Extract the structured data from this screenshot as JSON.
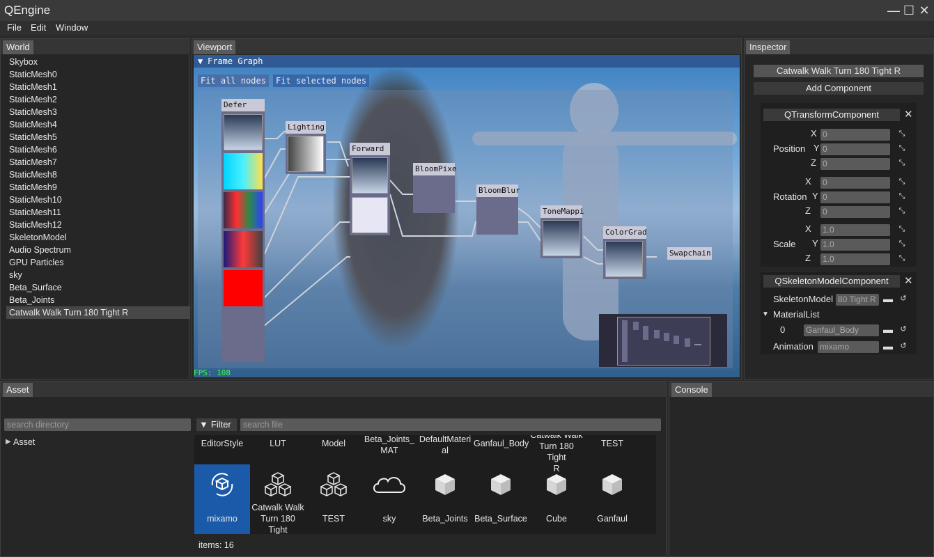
{
  "app": {
    "title": "QEngine"
  },
  "menu": [
    "File",
    "Edit",
    "Window"
  ],
  "world": {
    "tab": "World",
    "items": [
      "Skybox",
      "StaticMesh0",
      "StaticMesh1",
      "StaticMesh2",
      "StaticMesh3",
      "StaticMesh4",
      "StaticMesh5",
      "StaticMesh6",
      "StaticMesh7",
      "StaticMesh8",
      "StaticMesh9",
      "StaticMesh10",
      "StaticMesh11",
      "StaticMesh12",
      "SkeletonModel",
      "Audio Spectrum",
      "GPU Particles",
      "sky",
      "Beta_Surface",
      "Beta_Joints",
      "Catwalk Walk Turn 180 Tight R"
    ],
    "selected_index": 20
  },
  "viewport": {
    "tab": "Viewport",
    "frame_graph_title": "Frame Graph",
    "fit_all": "Fit all nodes",
    "fit_selected": "Fit selected nodes",
    "fps": "FPS: 108",
    "nodes": [
      "Defer",
      "Lighting",
      "Forward",
      "BloomPixe",
      "BloomBlur",
      "ToneMappi",
      "ColorGrad",
      "Swapchain"
    ]
  },
  "inspector": {
    "tab": "Inspector",
    "object_name": "Catwalk Walk Turn 180 Tight R",
    "add_component": "Add Component",
    "transform": {
      "title": "QTransformComponent",
      "position_label": "Position",
      "rotation_label": "Rotation",
      "scale_label": "Scale",
      "axis_x": "X",
      "axis_y": "Y",
      "axis_z": "Z",
      "position": [
        "0",
        "0",
        "0"
      ],
      "rotation": [
        "0",
        "0",
        "0"
      ],
      "scale": [
        "1.0",
        "1.0",
        "1.0"
      ]
    },
    "skeleton": {
      "title": "QSkeletonModelComponent",
      "skeleton_label": "SkeletonModel",
      "skeleton_value": "80 Tight R",
      "material_list_label": "MaterialList",
      "material_index": "0",
      "material_value": "Ganfaul_Body",
      "animation_label": "Animation",
      "animation_value": "mixamo"
    }
  },
  "asset": {
    "tab": "Asset",
    "search_directory_placeholder": "search directory",
    "tree_root": "Asset",
    "filter_label": "Filter",
    "search_file_placeholder": "search file",
    "top_row": [
      {
        "l1": "EditorStyle",
        "l2": "",
        "l3": ""
      },
      {
        "l1": "LUT",
        "l2": "",
        "l3": ""
      },
      {
        "l1": "Model",
        "l2": "",
        "l3": ""
      },
      {
        "l1": "Beta_Joints_",
        "l2": "MAT",
        "l3": ""
      },
      {
        "l1": "DefaultMateri",
        "l2": "al",
        "l3": ""
      },
      {
        "l1": "Ganfaul_Body",
        "l2": "",
        "l3": ""
      },
      {
        "l1": "Catwalk Walk",
        "l2": "Turn 180 Tight",
        "l3": "R"
      },
      {
        "l1": "TEST",
        "l2": "",
        "l3": ""
      }
    ],
    "items": [
      {
        "l1": "mixamo",
        "l2": "",
        "l3": "",
        "icon": "animation-icon",
        "selected": true
      },
      {
        "l1": "Catwalk Walk",
        "l2": "Turn 180 Tight",
        "l3": "R",
        "icon": "model-icon",
        "selected": false
      },
      {
        "l1": "TEST",
        "l2": "",
        "l3": "",
        "icon": "model-icon",
        "selected": false
      },
      {
        "l1": "sky",
        "l2": "",
        "l3": "",
        "icon": "cloud-icon",
        "selected": false
      },
      {
        "l1": "Beta_Joints",
        "l2": "",
        "l3": "",
        "icon": "mesh-icon",
        "selected": false
      },
      {
        "l1": "Beta_Surface",
        "l2": "",
        "l3": "",
        "icon": "mesh-icon",
        "selected": false
      },
      {
        "l1": "Cube",
        "l2": "",
        "l3": "",
        "icon": "mesh-icon",
        "selected": false
      },
      {
        "l1": "Ganfaul",
        "l2": "",
        "l3": "",
        "icon": "mesh-icon",
        "selected": false
      }
    ],
    "items_count": "items: 16",
    "accent": "#1a5aa8"
  },
  "console": {
    "tab": "Console"
  }
}
